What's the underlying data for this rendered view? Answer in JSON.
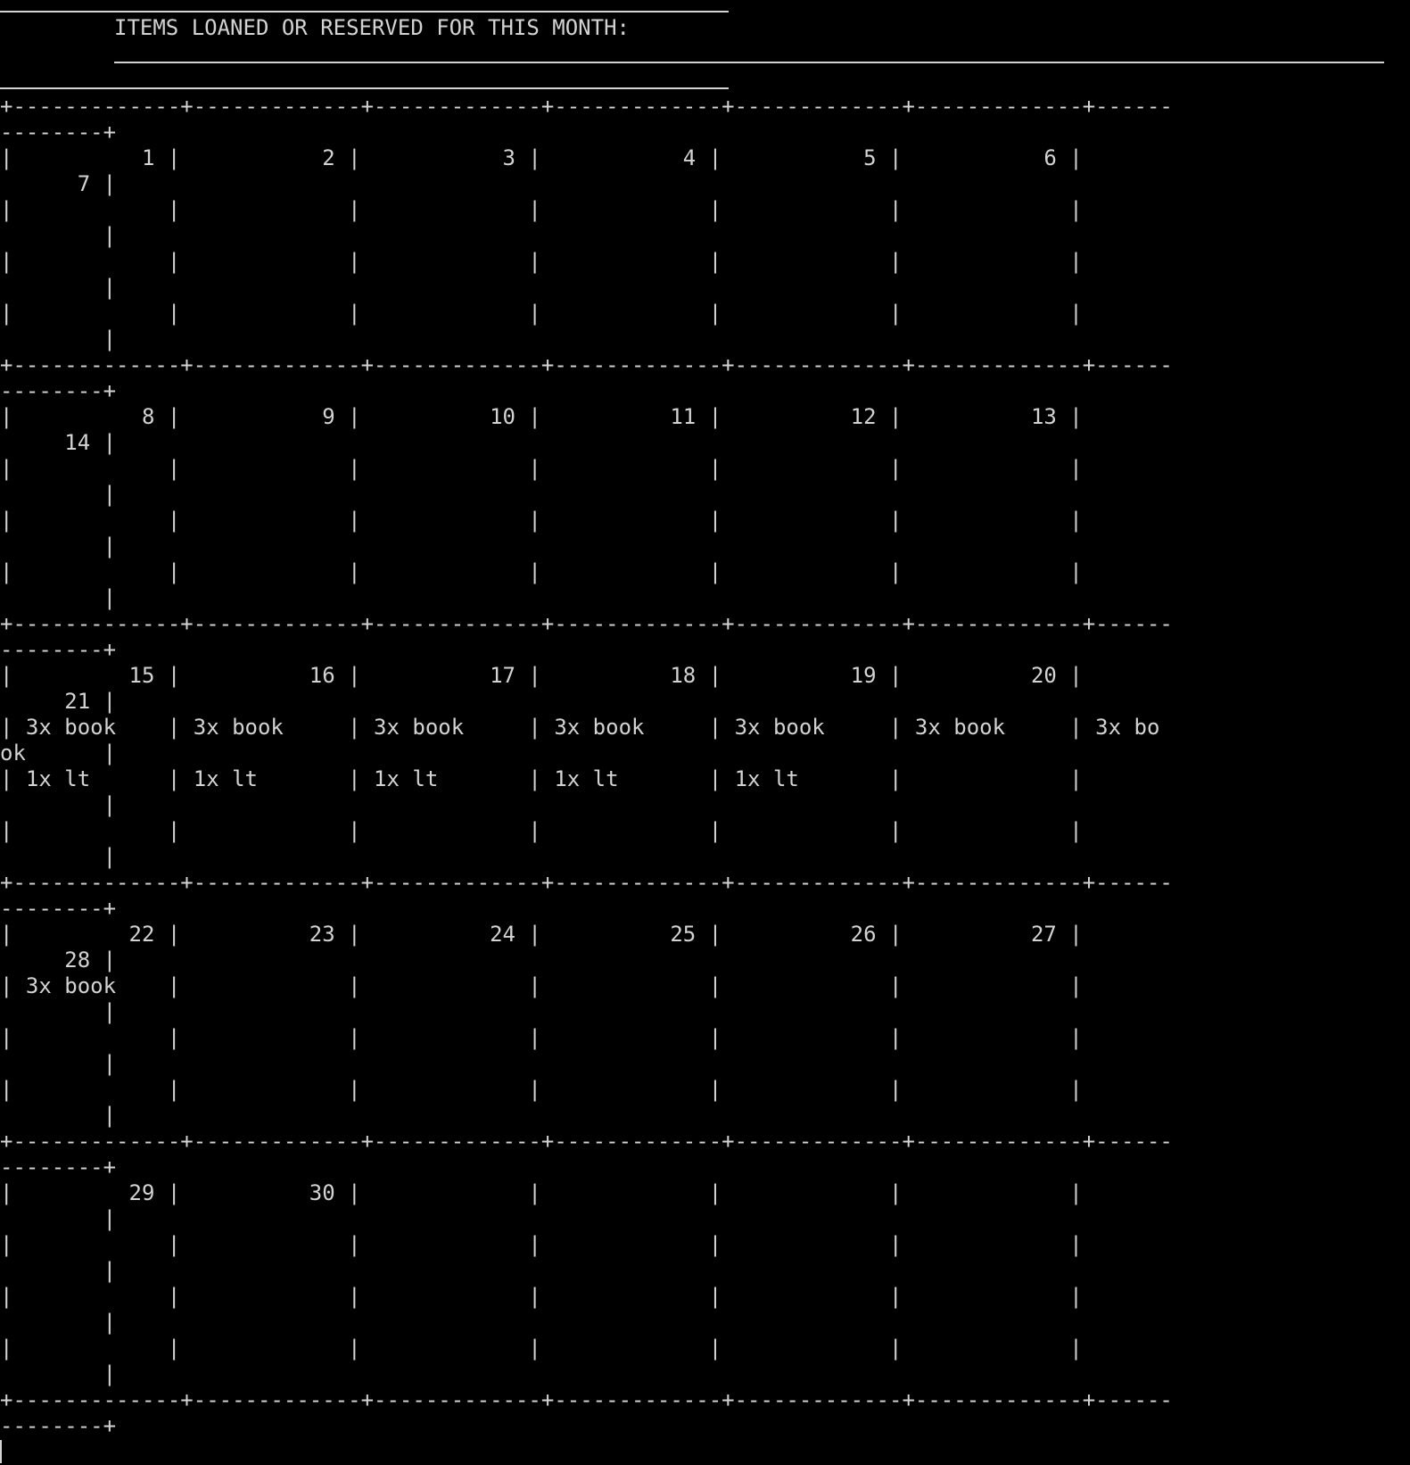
{
  "header": {
    "title": "ITEMS LOANED OR RESERVED FOR THIS MONTH:"
  },
  "terminal": {
    "lines": [
      "+-------------+-------------+-------------+-------------+-------------+-------------+------",
      "--------+",
      "|          1 |           2 |           3 |           4 |           5 |           6 |",
      "      7 |",
      "|            |             |             |             |             |             |",
      "        |",
      "|            |             |             |             |             |             |",
      "        |",
      "|            |             |             |             |             |             |",
      "        |",
      "+-------------+-------------+-------------+-------------+-------------+-------------+------",
      "--------+",
      "|          8 |           9 |          10 |          11 |          12 |          13 |",
      "     14 |",
      "|            |             |             |             |             |             |",
      "        |",
      "|            |             |             |             |             |             |",
      "        |",
      "|            |             |             |             |             |             |",
      "        |",
      "+-------------+-------------+-------------+-------------+-------------+-------------+------",
      "--------+",
      "|         15 |          16 |          17 |          18 |          19 |          20 |",
      "     21 |",
      "| 3x book    | 3x book     | 3x book     | 3x book     | 3x book     | 3x book     | 3x bo",
      "ok      |",
      "| 1x lt      | 1x lt       | 1x lt       | 1x lt       | 1x lt       |             |",
      "        |",
      "|            |             |             |             |             |             |",
      "        |",
      "+-------------+-------------+-------------+-------------+-------------+-------------+------",
      "--------+",
      "|         22 |          23 |          24 |          25 |          26 |          27 |",
      "     28 |",
      "| 3x book    |             |             |             |             |             |",
      "        |",
      "|            |             |             |             |             |             |",
      "        |",
      "|            |             |             |             |             |             |",
      "        |",
      "+-------------+-------------+-------------+-------------+-------------+-------------+------",
      "--------+",
      "|         29 |          30 |             |             |             |             |",
      "        |",
      "|            |             |             |             |             |             |",
      "        |",
      "|            |             |             |             |             |             |",
      "        |",
      "|            |             |             |             |             |             |",
      "        |",
      "+-------------+-------------+-------------+-------------+-------------+-------------+------",
      "--------+"
    ]
  }
}
